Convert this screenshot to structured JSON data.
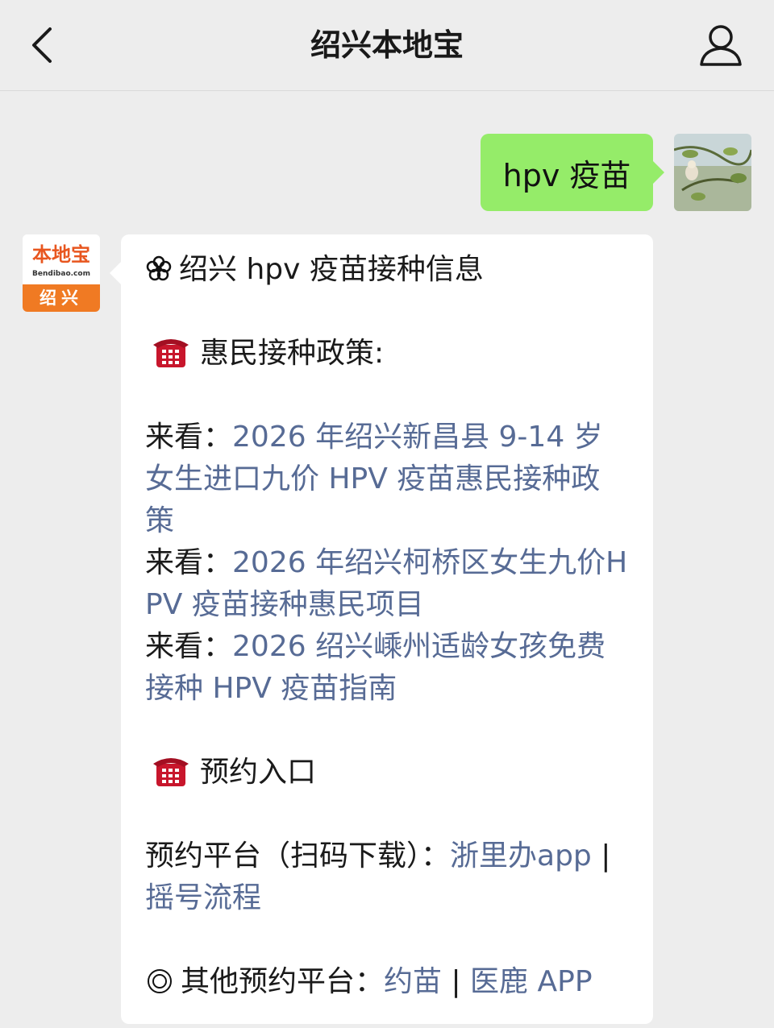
{
  "header": {
    "title": "绍兴本地宝",
    "back_icon": "chevron-left-icon",
    "profile_icon": "person-icon"
  },
  "user_message": {
    "text": "hpv 疫苗",
    "bubble_color": "#95ec69"
  },
  "bot": {
    "logo_name": "本地宝",
    "logo_domain": "Bendibao.com",
    "logo_city": "绍兴",
    "brand_color": "#f07a23"
  },
  "reply": {
    "heading": "绍兴 hpv 疫苗接种信息",
    "section1_title": "惠民接种政策:",
    "policies": [
      {
        "prefix": "来看：",
        "link": "2026 年绍兴新昌县 9-14 岁女生进口九价 HPV 疫苗惠民接种政策"
      },
      {
        "prefix": "来看：",
        "link": "2026 年绍兴柯桥区女生九价HPV 疫苗接种惠民项目"
      },
      {
        "prefix": "来看：",
        "link": "2026 绍兴嵊州适龄女孩免费接种 HPV 疫苗指南"
      }
    ],
    "section2_title": "预约入口",
    "platform_label": "预约平台（扫码下载）：",
    "platform_link1": "浙里办app",
    "separator": " | ",
    "platform_link2": "摇号流程",
    "other_label": "其他预约平台：",
    "other_link1": "约苗",
    "other_link2": "医鹿 APP",
    "link_color": "#576b95"
  }
}
